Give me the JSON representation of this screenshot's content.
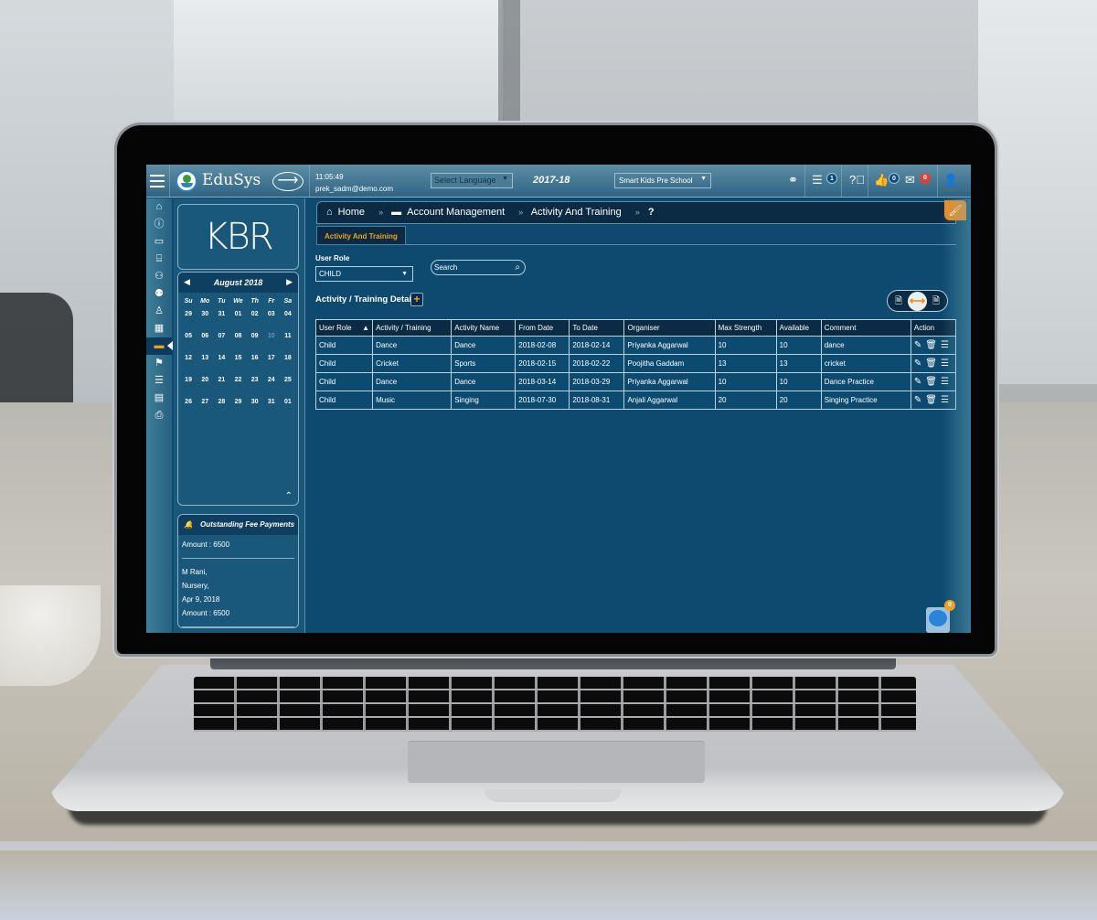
{
  "app": {
    "brand": "EduSys",
    "time": "11:05:49",
    "user_email": "prek_sadm@demo.com",
    "language_select": "Select Language",
    "academic_year": "2017-18",
    "school_select": "Smart Kids Pre School",
    "badges": {
      "tasks": "1",
      "likes": "0",
      "messages": "0",
      "chat": "0"
    }
  },
  "icons": {
    "menu": "hamburger-icon",
    "forward": "arrow-right-icon",
    "link": "link-icon",
    "tasks": "list-icon",
    "help": "question-icon",
    "like": "thumbs-up-icon",
    "mail": "envelope-icon",
    "user": "user-icon",
    "brush": "brush-icon",
    "chat": "chat-icon"
  },
  "rail": [
    {
      "name": "home",
      "glyph": "⌂"
    },
    {
      "name": "info",
      "glyph": "ℹ"
    },
    {
      "name": "monitor",
      "glyph": "▭"
    },
    {
      "name": "institution",
      "glyph": "⌸"
    },
    {
      "name": "add-user",
      "glyph": "👤"
    },
    {
      "name": "group",
      "glyph": "👥"
    },
    {
      "name": "person",
      "glyph": "♙"
    },
    {
      "name": "calculator",
      "glyph": "▦"
    },
    {
      "name": "card",
      "glyph": "▬"
    },
    {
      "name": "flag",
      "glyph": "⚑"
    },
    {
      "name": "list",
      "glyph": "☰"
    },
    {
      "name": "document",
      "glyph": "▤"
    },
    {
      "name": "print",
      "glyph": "⎙"
    }
  ],
  "sidebar": {
    "logo_text": "KBR",
    "calendar": {
      "title": "August 2018",
      "weekdays": [
        "Su",
        "Mo",
        "Tu",
        "We",
        "Th",
        "Fr",
        "Sa"
      ],
      "days": [
        "29",
        "30",
        "31",
        "01",
        "02",
        "03",
        "04",
        "05",
        "06",
        "07",
        "08",
        "09",
        "10",
        "11",
        "12",
        "13",
        "14",
        "15",
        "16",
        "17",
        "18",
        "19",
        "20",
        "21",
        "22",
        "23",
        "24",
        "25",
        "26",
        "27",
        "28",
        "29",
        "30",
        "31",
        "01"
      ],
      "highlight_day": "10"
    },
    "fees": {
      "title": "Outstanding Fee Payments",
      "entries": [
        {
          "lines": [
            "Amount : 6500"
          ]
        },
        {
          "lines": [
            "M Rani,",
            "Nursery,",
            "Apr 9, 2018",
            "Amount : 6500"
          ]
        }
      ]
    }
  },
  "breadcrumb": {
    "home": "Home",
    "section": "Account Management",
    "page": "Activity And Training",
    "help": "?"
  },
  "tab": "Activity And Training",
  "filters": {
    "user_role_label": "User Role",
    "user_role_value": "CHILD",
    "search_placeholder": "Search"
  },
  "details_title": "Activity / Training Details",
  "table": {
    "columns": [
      "User Role",
      "Activity / Training",
      "Activity Name",
      "From Date",
      "To Date",
      "Organiser",
      "Max Strength",
      "Available",
      "Comment",
      "Action"
    ],
    "rows": [
      [
        "Child",
        "Dance",
        "Dance",
        "2018-02-08",
        "2018-02-14",
        "Priyanka Aggarwal",
        "10",
        "10",
        "dance"
      ],
      [
        "Child",
        "Cricket",
        "Sports",
        "2018-02-15",
        "2018-02-22",
        "Poojitha Gaddam",
        "13",
        "13",
        "cricket"
      ],
      [
        "Child",
        "Dance",
        "Dance",
        "2018-03-14",
        "2018-03-29",
        "Priyanka Aggarwal",
        "10",
        "10",
        "Dance Practice"
      ],
      [
        "Child",
        "Music",
        "Singing",
        "2018-07-30",
        "2018-08-31",
        "Anjali Aggarwal",
        "20",
        "20",
        "Singing Practice"
      ]
    ]
  },
  "colors": {
    "accent": "#f0a020",
    "screen_bg": "#0e4a70",
    "header_dark": "#0b2b45"
  }
}
